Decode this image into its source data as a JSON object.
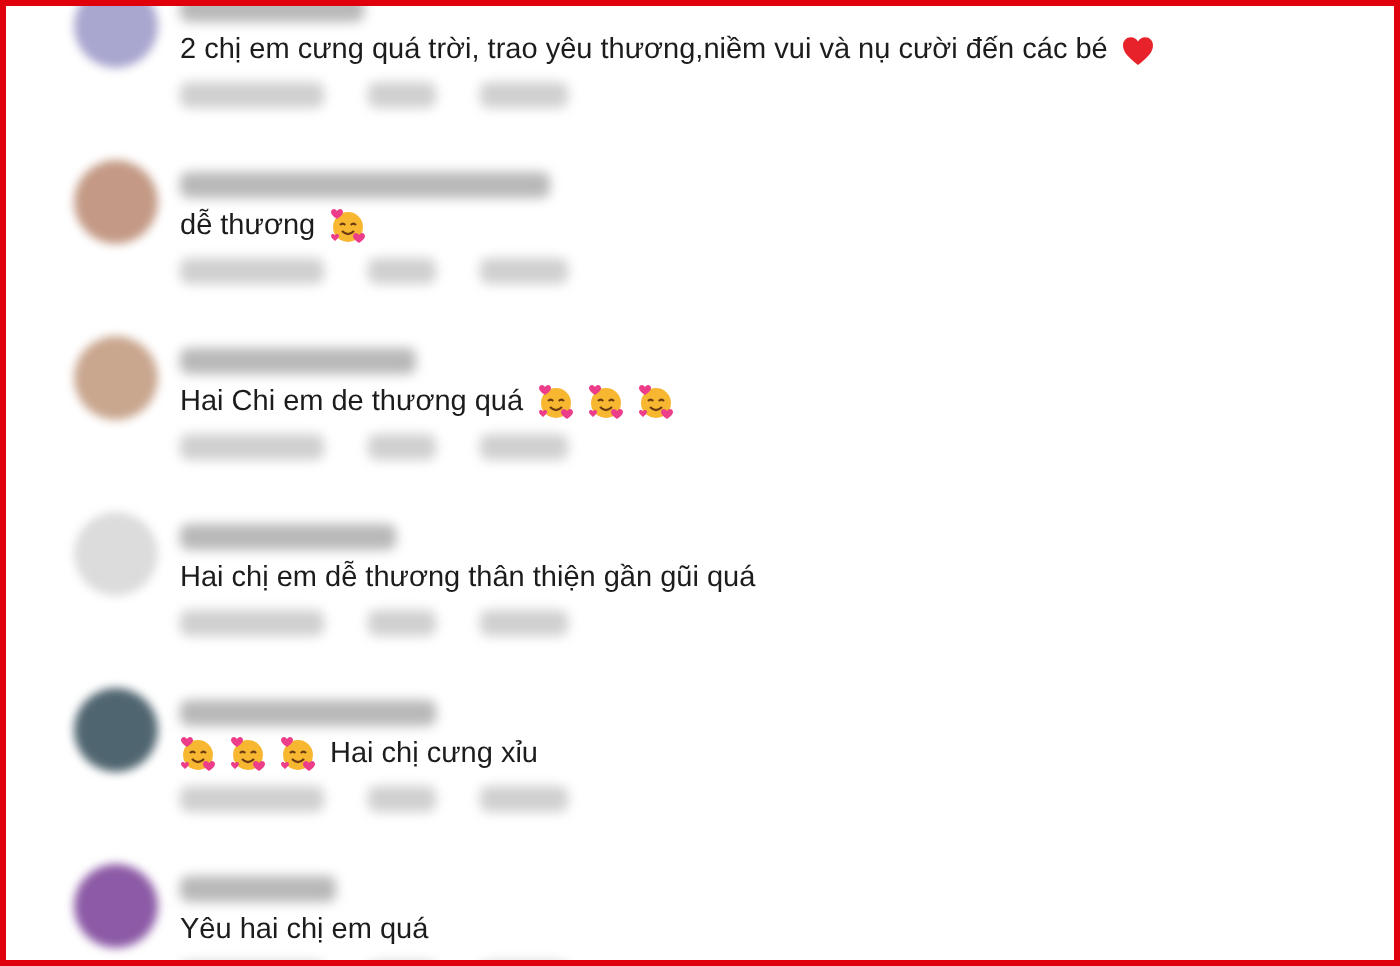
{
  "comments": [
    {
      "segments": [
        {
          "kind": "text",
          "text": "2 chị em cưng quá trời, trao yêu thương,niềm vui và nụ cười đến các bé"
        },
        {
          "kind": "heart"
        }
      ]
    },
    {
      "segments": [
        {
          "kind": "text",
          "text": "dễ thương"
        },
        {
          "kind": "hug"
        }
      ]
    },
    {
      "segments": [
        {
          "kind": "text",
          "text": "Hai Chi em de thương quá"
        },
        {
          "kind": "hug"
        },
        {
          "kind": "hug"
        },
        {
          "kind": "hug"
        }
      ]
    },
    {
      "segments": [
        {
          "kind": "text",
          "text": "Hai chị em dễ thương thân thiện gần gũi quá"
        }
      ]
    },
    {
      "segments": [
        {
          "kind": "hug"
        },
        {
          "kind": "hug"
        },
        {
          "kind": "hug"
        },
        {
          "kind": "text",
          "text": "Hai chị cưng xỉu"
        }
      ]
    },
    {
      "segments": [
        {
          "kind": "text",
          "text": "Yêu hai chị em quá"
        }
      ]
    }
  ]
}
